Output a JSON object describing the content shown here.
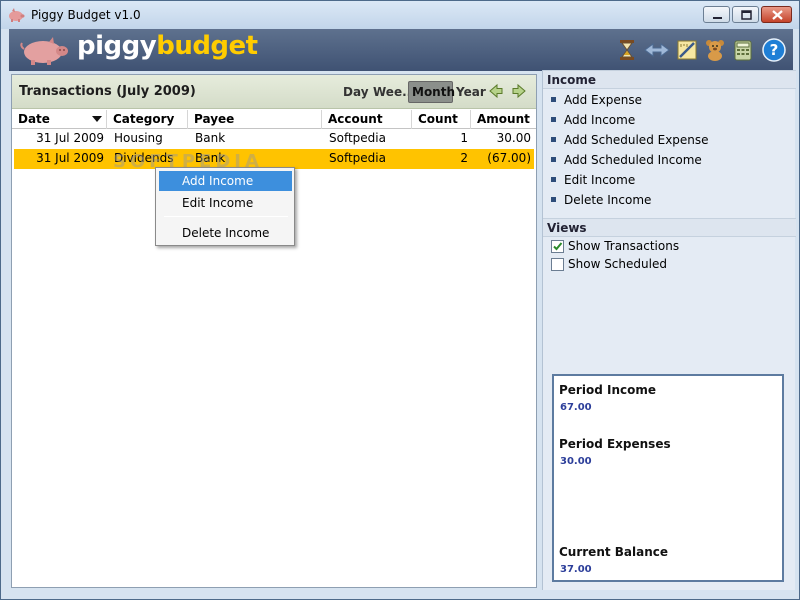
{
  "window": {
    "title": "Piggy Budget v1.0"
  },
  "banner": {
    "brand_part1": "piggy",
    "brand_part2": "budget",
    "toolbar_icons": [
      "hourglass-icon",
      "transfer-arrows-icon",
      "ruler-edit-icon",
      "teddy-bear-icon",
      "calculator-icon",
      "help-icon"
    ],
    "help_glyph": "?"
  },
  "main": {
    "title": "Transactions (July 2009)",
    "view_buttons": [
      "Day",
      "Wee...",
      "Month",
      "Year"
    ],
    "active_view": "Month",
    "columns": [
      "Date",
      "Category",
      "Payee",
      "Account",
      "Count",
      "Amount"
    ],
    "rows": [
      {
        "date": "31 Jul 2009",
        "category": "Housing",
        "payee": "Bank",
        "account": "Softpedia",
        "count": "1",
        "amount": "30.00"
      },
      {
        "date": "31 Jul 2009",
        "category": "Dividends",
        "payee": "Bank",
        "account": "Softpedia",
        "count": "2",
        "amount": "(67.00)"
      }
    ],
    "selected_row": 1,
    "watermark": "SOFTPEDIA"
  },
  "context_menu": {
    "items": [
      "Add Income",
      "Edit Income",
      "Delete Income"
    ],
    "highlighted": "Add Income"
  },
  "side": {
    "income_header": "Income",
    "income_items": [
      "Add Expense",
      "Add Income",
      "Add Scheduled Expense",
      "Add Scheduled Income",
      "Edit Income",
      "Delete Income"
    ],
    "views_header": "Views",
    "views": [
      {
        "label": "Show Transactions",
        "checked": true
      },
      {
        "label": "Show Scheduled",
        "checked": false
      }
    ],
    "summary": {
      "period_income_label": "Period Income",
      "period_income_value": "67.00",
      "period_expenses_label": "Period Expenses",
      "period_expenses_value": "30.00",
      "current_balance_label": "Current Balance",
      "current_balance_value": "37.00"
    }
  },
  "colors": {
    "selected_row": "#ffc300",
    "menu_highlight": "#3d8fdd",
    "brand_accent": "#ffcc00",
    "summary_value": "#2c3e9a"
  }
}
